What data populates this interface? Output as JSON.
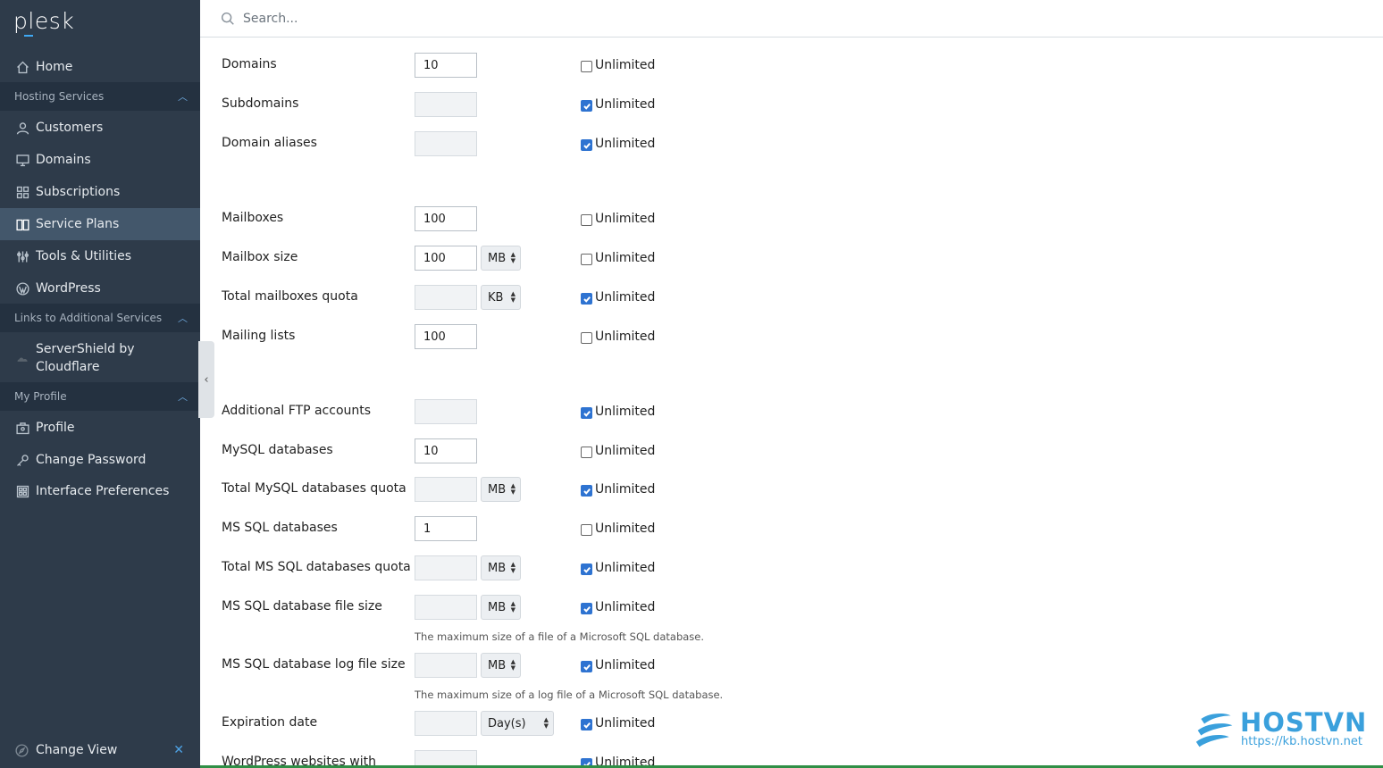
{
  "brand": {
    "logo": "plesk"
  },
  "search": {
    "placeholder": "Search..."
  },
  "sidebar": {
    "home": "Home",
    "section_hosting": "Hosting Services",
    "customers": "Customers",
    "domains": "Domains",
    "subscriptions": "Subscriptions",
    "service_plans": "Service Plans",
    "tools": "Tools & Utilities",
    "wordpress": "WordPress",
    "section_links": "Links to Additional Services",
    "servershield_line1": "ServerShield by",
    "servershield_line2": "Cloudflare",
    "section_profile": "My Profile",
    "profile": "Profile",
    "change_password": "Change Password",
    "interface_prefs": "Interface Preferences",
    "change_view": "Change View"
  },
  "form": {
    "unlimited_label": "Unlimited",
    "rows": [
      {
        "label": "Domains",
        "value": "10",
        "unit": "",
        "unlimited": false
      },
      {
        "label": "Subdomains",
        "value": "",
        "unit": "",
        "unlimited": true
      },
      {
        "label": "Domain aliases",
        "value": "",
        "unit": "",
        "unlimited": true
      },
      {
        "label": "Mailboxes",
        "value": "100",
        "unit": "",
        "unlimited": false
      },
      {
        "label": "Mailbox size",
        "value": "100",
        "unit": "MB",
        "unlimited": false
      },
      {
        "label": "Total mailboxes quota",
        "value": "",
        "unit": "KB",
        "unlimited": true
      },
      {
        "label": "Mailing lists",
        "value": "100",
        "unit": "",
        "unlimited": false
      },
      {
        "label": "Additional FTP accounts",
        "value": "",
        "unit": "",
        "unlimited": true
      },
      {
        "label": "MySQL databases",
        "value": "10",
        "unit": "",
        "unlimited": false
      },
      {
        "label": "Total MySQL databases quota",
        "value": "",
        "unit": "MB",
        "unlimited": true
      },
      {
        "label": "MS SQL databases",
        "value": "1",
        "unit": "",
        "unlimited": false
      },
      {
        "label": "Total MS SQL databases quota",
        "value": "",
        "unit": "MB",
        "unlimited": true
      },
      {
        "label": "MS SQL database file size",
        "value": "",
        "unit": "MB",
        "unlimited": true,
        "hint": "The maximum size of a file of a Microsoft SQL database."
      },
      {
        "label": "MS SQL database log file size",
        "value": "",
        "unit": "MB",
        "unlimited": true,
        "hint": "The maximum size of a log file of a Microsoft SQL database."
      },
      {
        "label": "Expiration date",
        "value": "",
        "unit": "Day(s)",
        "unlimited": true
      },
      {
        "label": "WordPress websites with",
        "value": "",
        "unit": "",
        "unlimited": true
      }
    ]
  },
  "watermark": {
    "brand": "HOSTVN",
    "url": "https://kb.hostvn.net"
  }
}
